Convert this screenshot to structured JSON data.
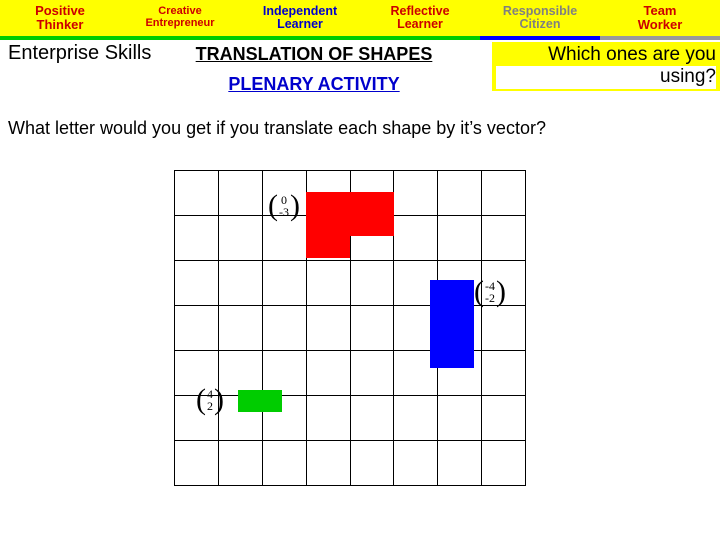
{
  "skills_bar": {
    "tabs": [
      {
        "line1": "Positive",
        "line2": "Thinker"
      },
      {
        "line1": "Creative",
        "line2": "Entrepreneur"
      },
      {
        "line1": "Independent",
        "line2": "Learner"
      },
      {
        "line1": "Reflective",
        "line2": "Learner"
      },
      {
        "line1": "Responsible",
        "line2": "Citizen"
      },
      {
        "line1": "Team",
        "line2": "Worker"
      }
    ]
  },
  "header": {
    "enterprise_label": "Enterprise Skills",
    "title": "TRANSLATION OF SHAPES",
    "subtitle": "PLENARY ACTIVITY",
    "callout_line1": "Which ones are you",
    "callout_line2": "using?"
  },
  "question": "What letter would you get if you translate each shape by it’s vector?",
  "grid": {
    "columns": 8,
    "rows": 7
  },
  "shapes": [
    {
      "name": "red-shape",
      "color": "#ff0000",
      "vector_x": "0",
      "vector_y": "-3"
    },
    {
      "name": "blue-shape",
      "color": "#0000ff",
      "vector_x": "-4",
      "vector_y": "-2"
    },
    {
      "name": "green-shape",
      "color": "#00cc00",
      "vector_x": "4",
      "vector_y": "2"
    }
  ]
}
